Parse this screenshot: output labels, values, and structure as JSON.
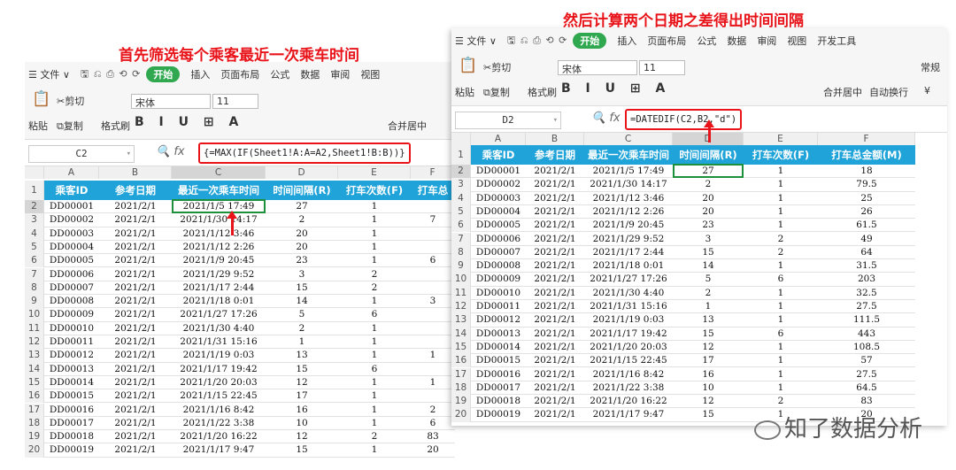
{
  "captions": {
    "left": "首先筛选每个乘客最近一次乘车时间",
    "right": "然后计算两个日期之差得出时间间隔"
  },
  "menu": {
    "file": "☰ 文件 ∨",
    "start": "开始",
    "items_left": [
      "插入",
      "页面布局",
      "公式",
      "数据",
      "审阅",
      "视图"
    ],
    "items_right": [
      "插入",
      "页面布局",
      "公式",
      "数据",
      "审阅",
      "视图",
      "开发工具"
    ]
  },
  "ribbon": {
    "cut": "剪切",
    "paste": "粘贴",
    "copy": "复制",
    "format_painter": "格式刷",
    "font": "宋体",
    "size": "11",
    "merge": "合并居中",
    "wrap": "自动换行",
    "normal": "常规",
    "currency": "¥"
  },
  "left": {
    "cell_ref": "C2",
    "formula": "{=MAX(IF(Sheet1!A:A=A2,Sheet1!B:B))}",
    "col_letters": [
      "A",
      "B",
      "C",
      "D",
      "E",
      "F"
    ],
    "headers": [
      "乘客ID",
      "参考日期",
      "最近一次乘车时间",
      "时间间隔(R)",
      "打车次数(F)",
      "打车总"
    ],
    "rows": [
      [
        "2",
        "DD00001",
        "2021/2/1",
        "2021/1/5 17:49",
        "27",
        "1",
        ""
      ],
      [
        "3",
        "DD00002",
        "2021/2/1",
        "2021/1/30 14:17",
        "2",
        "1",
        "7"
      ],
      [
        "4",
        "DD00003",
        "2021/2/1",
        "2021/1/12 3:46",
        "20",
        "1",
        ""
      ],
      [
        "5",
        "DD00004",
        "2021/2/1",
        "2021/1/12 2:26",
        "20",
        "1",
        ""
      ],
      [
        "6",
        "DD00005",
        "2021/2/1",
        "2021/1/9 20:45",
        "23",
        "1",
        "6"
      ],
      [
        "7",
        "DD00006",
        "2021/2/1",
        "2021/1/29 9:52",
        "3",
        "2",
        ""
      ],
      [
        "8",
        "DD00007",
        "2021/2/1",
        "2021/1/17 2:44",
        "15",
        "2",
        ""
      ],
      [
        "9",
        "DD00008",
        "2021/2/1",
        "2021/1/18 0:01",
        "14",
        "1",
        "3"
      ],
      [
        "10",
        "DD00009",
        "2021/2/1",
        "2021/1/27 17:26",
        "5",
        "6",
        ""
      ],
      [
        "11",
        "DD00010",
        "2021/2/1",
        "2021/1/30 4:40",
        "2",
        "1",
        ""
      ],
      [
        "12",
        "DD00011",
        "2021/2/1",
        "2021/1/31 15:16",
        "1",
        "1",
        ""
      ],
      [
        "13",
        "DD00012",
        "2021/2/1",
        "2021/1/19 0:03",
        "13",
        "1",
        "1"
      ],
      [
        "14",
        "DD00013",
        "2021/2/1",
        "2021/1/17 19:42",
        "15",
        "6",
        ""
      ],
      [
        "15",
        "DD00014",
        "2021/2/1",
        "2021/1/20 20:03",
        "12",
        "1",
        "1"
      ],
      [
        "16",
        "DD00015",
        "2021/2/1",
        "2021/1/15 22:45",
        "17",
        "1",
        ""
      ],
      [
        "17",
        "DD00016",
        "2021/2/1",
        "2021/1/16 8:42",
        "16",
        "1",
        "2"
      ],
      [
        "18",
        "DD00017",
        "2021/2/1",
        "2021/1/22 3:38",
        "10",
        "1",
        "6"
      ],
      [
        "19",
        "DD00018",
        "2021/2/1",
        "2021/1/20 16:22",
        "12",
        "2",
        "83"
      ],
      [
        "20",
        "DD00019",
        "2021/2/1",
        "2021/1/17 9:47",
        "15",
        "1",
        "20"
      ]
    ]
  },
  "right": {
    "cell_ref": "D2",
    "formula": "=DATEDIF(C2,B2,\"d\")",
    "col_letters": [
      "A",
      "B",
      "C",
      "D",
      "E",
      "F"
    ],
    "headers": [
      "乘客ID",
      "参考日期",
      "最近一次乘车时间",
      "时间间隔(R)",
      "打车次数(F)",
      "打车总金额(M)"
    ],
    "rows": [
      [
        "2",
        "DD00001",
        "2021/2/1",
        "2021/1/5 17:49",
        "27",
        "1",
        "18"
      ],
      [
        "3",
        "DD00002",
        "2021/2/1",
        "2021/1/30 14:17",
        "2",
        "1",
        "79.5"
      ],
      [
        "4",
        "DD00003",
        "2021/2/1",
        "2021/1/12 3:46",
        "20",
        "1",
        "25"
      ],
      [
        "5",
        "DD00004",
        "2021/2/1",
        "2021/1/12 2:26",
        "20",
        "1",
        "26"
      ],
      [
        "6",
        "DD00005",
        "2021/2/1",
        "2021/1/9 20:45",
        "23",
        "1",
        "61.5"
      ],
      [
        "7",
        "DD00006",
        "2021/2/1",
        "2021/1/29 9:52",
        "3",
        "2",
        "49"
      ],
      [
        "8",
        "DD00007",
        "2021/2/1",
        "2021/1/17 2:44",
        "15",
        "2",
        "64"
      ],
      [
        "9",
        "DD00008",
        "2021/2/1",
        "2021/1/18 0:01",
        "14",
        "1",
        "31.5"
      ],
      [
        "10",
        "DD00009",
        "2021/2/1",
        "2021/1/27 17:26",
        "5",
        "6",
        "203"
      ],
      [
        "11",
        "DD00010",
        "2021/2/1",
        "2021/1/30 4:40",
        "2",
        "1",
        "32.5"
      ],
      [
        "12",
        "DD00011",
        "2021/2/1",
        "2021/1/31 15:16",
        "1",
        "1",
        "27.5"
      ],
      [
        "13",
        "DD00012",
        "2021/2/1",
        "2021/1/19 0:03",
        "13",
        "1",
        "111.5"
      ],
      [
        "14",
        "DD00013",
        "2021/2/1",
        "2021/1/17 19:42",
        "15",
        "6",
        "443"
      ],
      [
        "15",
        "DD00014",
        "2021/2/1",
        "2021/1/20 20:03",
        "12",
        "1",
        "108.5"
      ],
      [
        "16",
        "DD00015",
        "2021/2/1",
        "2021/1/15 22:45",
        "17",
        "1",
        "57"
      ],
      [
        "17",
        "DD00016",
        "2021/2/1",
        "2021/1/16 8:42",
        "16",
        "1",
        "27.5"
      ],
      [
        "18",
        "DD00017",
        "2021/2/1",
        "2021/1/22 3:38",
        "10",
        "1",
        "64.5"
      ],
      [
        "19",
        "DD00018",
        "2021/2/1",
        "2021/1/20 16:22",
        "12",
        "2",
        "83"
      ],
      [
        "20",
        "DD00019",
        "2021/2/1",
        "2021/1/17 9:47",
        "15",
        "1",
        "20"
      ]
    ]
  },
  "watermark": "知了数据分析",
  "colors": {
    "header": "#1fa3d8",
    "accent": "#e8141a",
    "selection": "#1e8f3a",
    "start": "#2fa84f"
  }
}
